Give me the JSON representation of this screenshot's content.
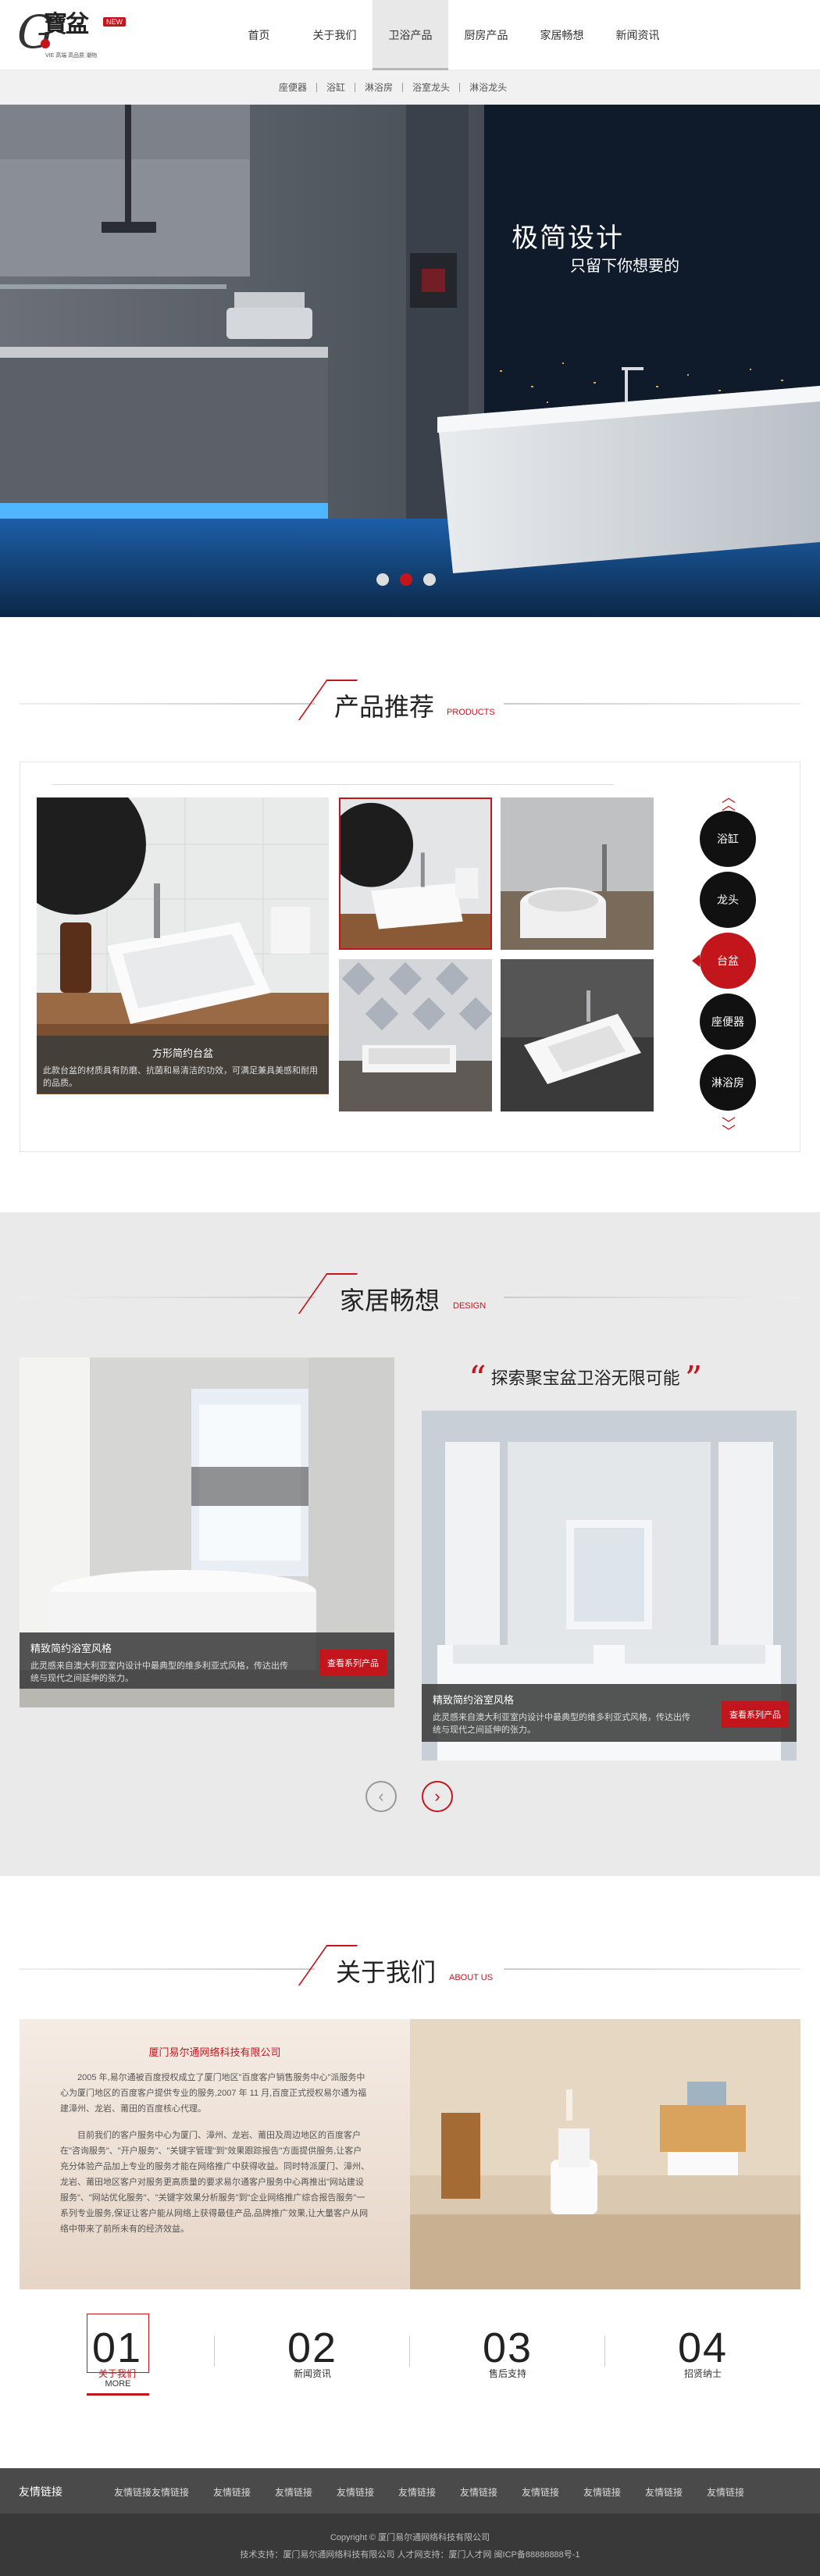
{
  "logo": {
    "letter": "G",
    "cn": "寶盆",
    "badge": "NEW",
    "tagline": "VIE 高端 高品质 潮物"
  },
  "nav": {
    "items": [
      "首页",
      "关于我们",
      "卫浴产品",
      "厨房产品",
      "家居畅想",
      "新闻资讯"
    ],
    "active_index": 2
  },
  "subnav": [
    "座便器",
    "浴缸",
    "淋浴房",
    "浴室龙头",
    "淋浴龙头"
  ],
  "hero": {
    "title": "极简设计",
    "subtitle": "只留下你想要的",
    "slide_count": 3,
    "active_slide": 1
  },
  "products": {
    "title_cn": "产品推荐",
    "title_en": "PRODUCTS",
    "featured": {
      "name": "方形简约台盆",
      "desc": "此款台盆的材质具有防磨、抗菌和易清洁的功效，可满足兼具美感和耐用的品质。"
    },
    "categories": [
      "浴缸",
      "龙头",
      "台盆",
      "座便器",
      "淋浴房"
    ],
    "active_category": 2
  },
  "home": {
    "title_cn": "家居畅想",
    "title_en": "DESIGN",
    "slogan": "探索聚宝盆卫浴无限可能",
    "cards": [
      {
        "title": "精致简约浴室风格",
        "desc": "此灵感来自澳大利亚室内设计中最典型的维多利亚式风格，传达出传统与现代之间延伸的张力。",
        "button": "查看系列产品"
      },
      {
        "title": "精致简约浴室风格",
        "desc": "此灵感来自澳大利亚室内设计中最典型的维多利亚式风格，传达出传统与现代之间延伸的张力。",
        "button": "查看系列产品"
      }
    ],
    "prev": "‹",
    "next": "›"
  },
  "about": {
    "title_cn": "关于我们",
    "title_en": "ABOUT US",
    "company": "厦门易尔通网络科技有限公司",
    "p1": "2005 年,易尔通被百度授权成立了厦门地区\"百度客户销售服务中心\"派服务中心为厦门地区的百度客户提供专业的服务,2007 年 11 月,百度正式授权易尔通为福建漳州、龙岩、莆田的百度核心代理。",
    "p2": "目前我们的客户服务中心为厦门、漳州、龙岩、莆田及周边地区的百度客户在\"咨询服务\"、\"开户服务\"、\"关键字管理\"到\"效果跟踪报告\"方面提供服务,让客户充分体验产品加上专业的服务才能在网络推广中获得收益。同时特派厦门、漳州、龙岩、莆田地区客户对服务更高质量的要求易尔通客户服务中心再推出\"网站建设服务\"、\"网站优化服务\"、\"关键字效果分析服务\"到\"企业网络推广综合报告服务\"一系列专业服务,保证让客户能从网络上获得最佳产品,品牌推广效果,让大量客户从网络中带来了前所未有的经济效益。",
    "tabs": [
      {
        "num": "01",
        "label": "关于我们"
      },
      {
        "num": "02",
        "label": "新闻资讯"
      },
      {
        "num": "03",
        "label": "售后支持"
      },
      {
        "num": "04",
        "label": "招贤纳士"
      }
    ],
    "active_tab": 0,
    "more": "MORE"
  },
  "footer": {
    "links_heading": "友情链接",
    "links": [
      "友情链接",
      "友情链接",
      "友情链接",
      "友情链接",
      "友情链接",
      "友情链接",
      "友情链接",
      "友情链接",
      "友情链接",
      "友情链接",
      "友情链接"
    ],
    "copyright": "Copyright © 厦门易尔通网络科技有限公司",
    "support": "技术支持：厦门易尔通网络科技有限公司 人才网支持：厦门人才网 闽ICP备88888888号-1"
  },
  "colors": {
    "accent": "#c3161c",
    "dark": "#111111",
    "footer": "#4a4a4a"
  }
}
